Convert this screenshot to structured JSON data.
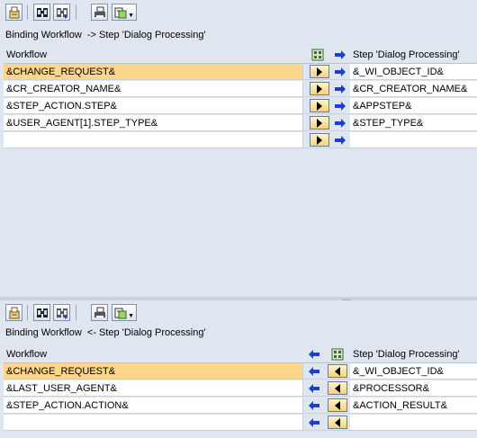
{
  "window": {
    "title": ""
  },
  "top": {
    "title": "Binding Workflow  -> Step 'Dialog Processing'",
    "col_workflow": "Workflow",
    "col_step": "Step 'Dialog Processing'",
    "rows": [
      {
        "workflow": "&CHANGE_REQUEST&",
        "step": "&_WI_OBJECT_ID&",
        "selected": true
      },
      {
        "workflow": "&CR_CREATOR_NAME&",
        "step": "&CR_CREATOR_NAME&",
        "selected": false
      },
      {
        "workflow": "&STEP_ACTION.STEP&",
        "step": "&APPSTEP&",
        "selected": false
      },
      {
        "workflow": "&USER_AGENT[1].STEP_TYPE&",
        "step": "&STEP_TYPE&",
        "selected": false
      },
      {
        "workflow": "",
        "step": "",
        "selected": false
      }
    ]
  },
  "bottom": {
    "title": "Binding Workflow  <- Step 'Dialog Processing'",
    "col_workflow": "Workflow",
    "col_step": "Step 'Dialog Processing'",
    "rows": [
      {
        "workflow": "&CHANGE_REQUEST&",
        "step": "&_WI_OBJECT_ID&",
        "selected": true
      },
      {
        "workflow": "&LAST_USER_AGENT&",
        "step": "&PROCESSOR&",
        "selected": false
      },
      {
        "workflow": "&STEP_ACTION.ACTION&",
        "step": "&ACTION_RESULT&",
        "selected": false
      },
      {
        "workflow": "",
        "step": "",
        "selected": false
      }
    ]
  },
  "toolbar": {
    "icons": [
      "details-icon",
      "find-icon",
      "find-next-icon",
      "print-icon",
      "export-icon"
    ]
  },
  "colors": {
    "background": "#dfe6ef",
    "selected_row": "#fcd68b",
    "arrow_blue": "#1b3fd6"
  }
}
